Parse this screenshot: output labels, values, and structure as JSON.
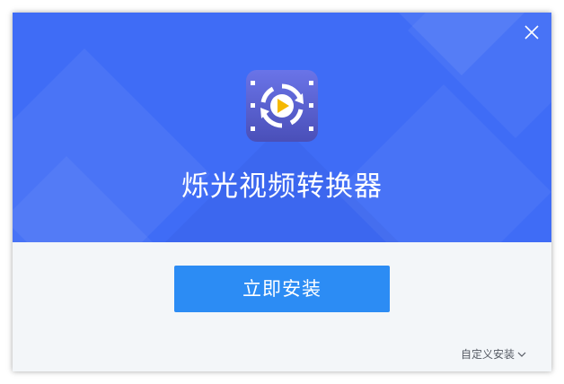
{
  "window": {
    "accent_color": "#3f6cf6",
    "button_color": "#2c8cf4"
  },
  "header": {
    "close_icon": "close-icon",
    "app_icon": "video-converter-app-icon",
    "app_title": "烁光视频转换器"
  },
  "actions": {
    "install_label": "立即安装",
    "custom_install_label": "自定义安装",
    "custom_install_icon": "chevron-down-icon"
  }
}
